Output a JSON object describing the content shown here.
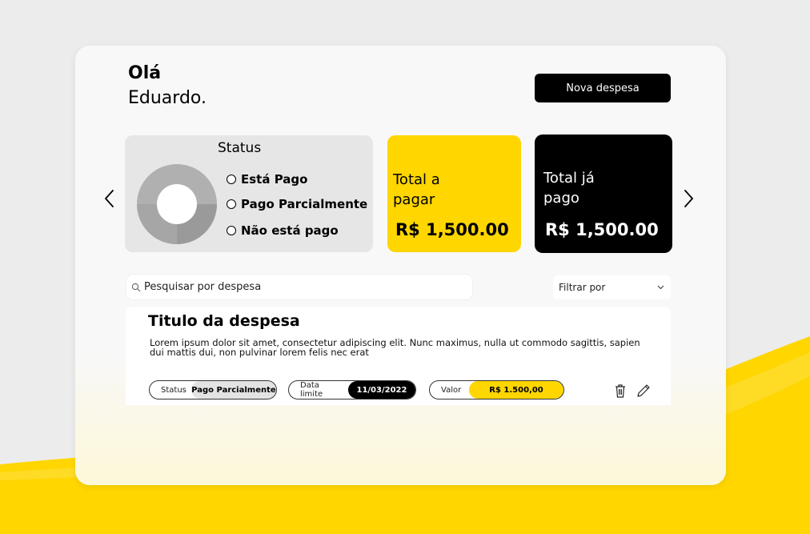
{
  "greeting": {
    "hello": "Olá",
    "name": "Eduardo."
  },
  "actions": {
    "new_expense_label": "Nova despesa"
  },
  "status_card": {
    "title": "Status",
    "legend": [
      "Está Pago",
      "Pago Parcialmente",
      "Não está pago"
    ]
  },
  "totals": {
    "to_pay_label_line1": "Total a",
    "to_pay_label_line2": "pagar",
    "to_pay_amount": "R$ 1,500.00",
    "paid_label_line1": "Total já",
    "paid_label_line2": "pago",
    "paid_amount": "R$ 1,500.00"
  },
  "search": {
    "placeholder": "Pesquisar por despesa"
  },
  "filter": {
    "label": "Filtrar por"
  },
  "expense": {
    "title": "Titulo da despesa",
    "description": "Lorem ipsum dolor sit amet, consectetur adipiscing elit. Nunc maximus, nulla ut commodo sagittis, sapien dui mattis dui, non pulvinar lorem felis nec erat",
    "status_label": "Status",
    "status_value": "Pago Parcialmente",
    "due_label": "Data limite",
    "due_value": "11/03/2022",
    "value_label": "Valor",
    "value_amount": "R$ 1.500,00"
  },
  "colors": {
    "accent": "#ffd600",
    "dark": "#000000",
    "background": "#ececec",
    "card": "#f8f8f8"
  },
  "icons": [
    "arrow-left-icon",
    "arrow-right-icon",
    "search-icon",
    "chevron-down-icon",
    "trash-icon",
    "pencil-icon"
  ]
}
